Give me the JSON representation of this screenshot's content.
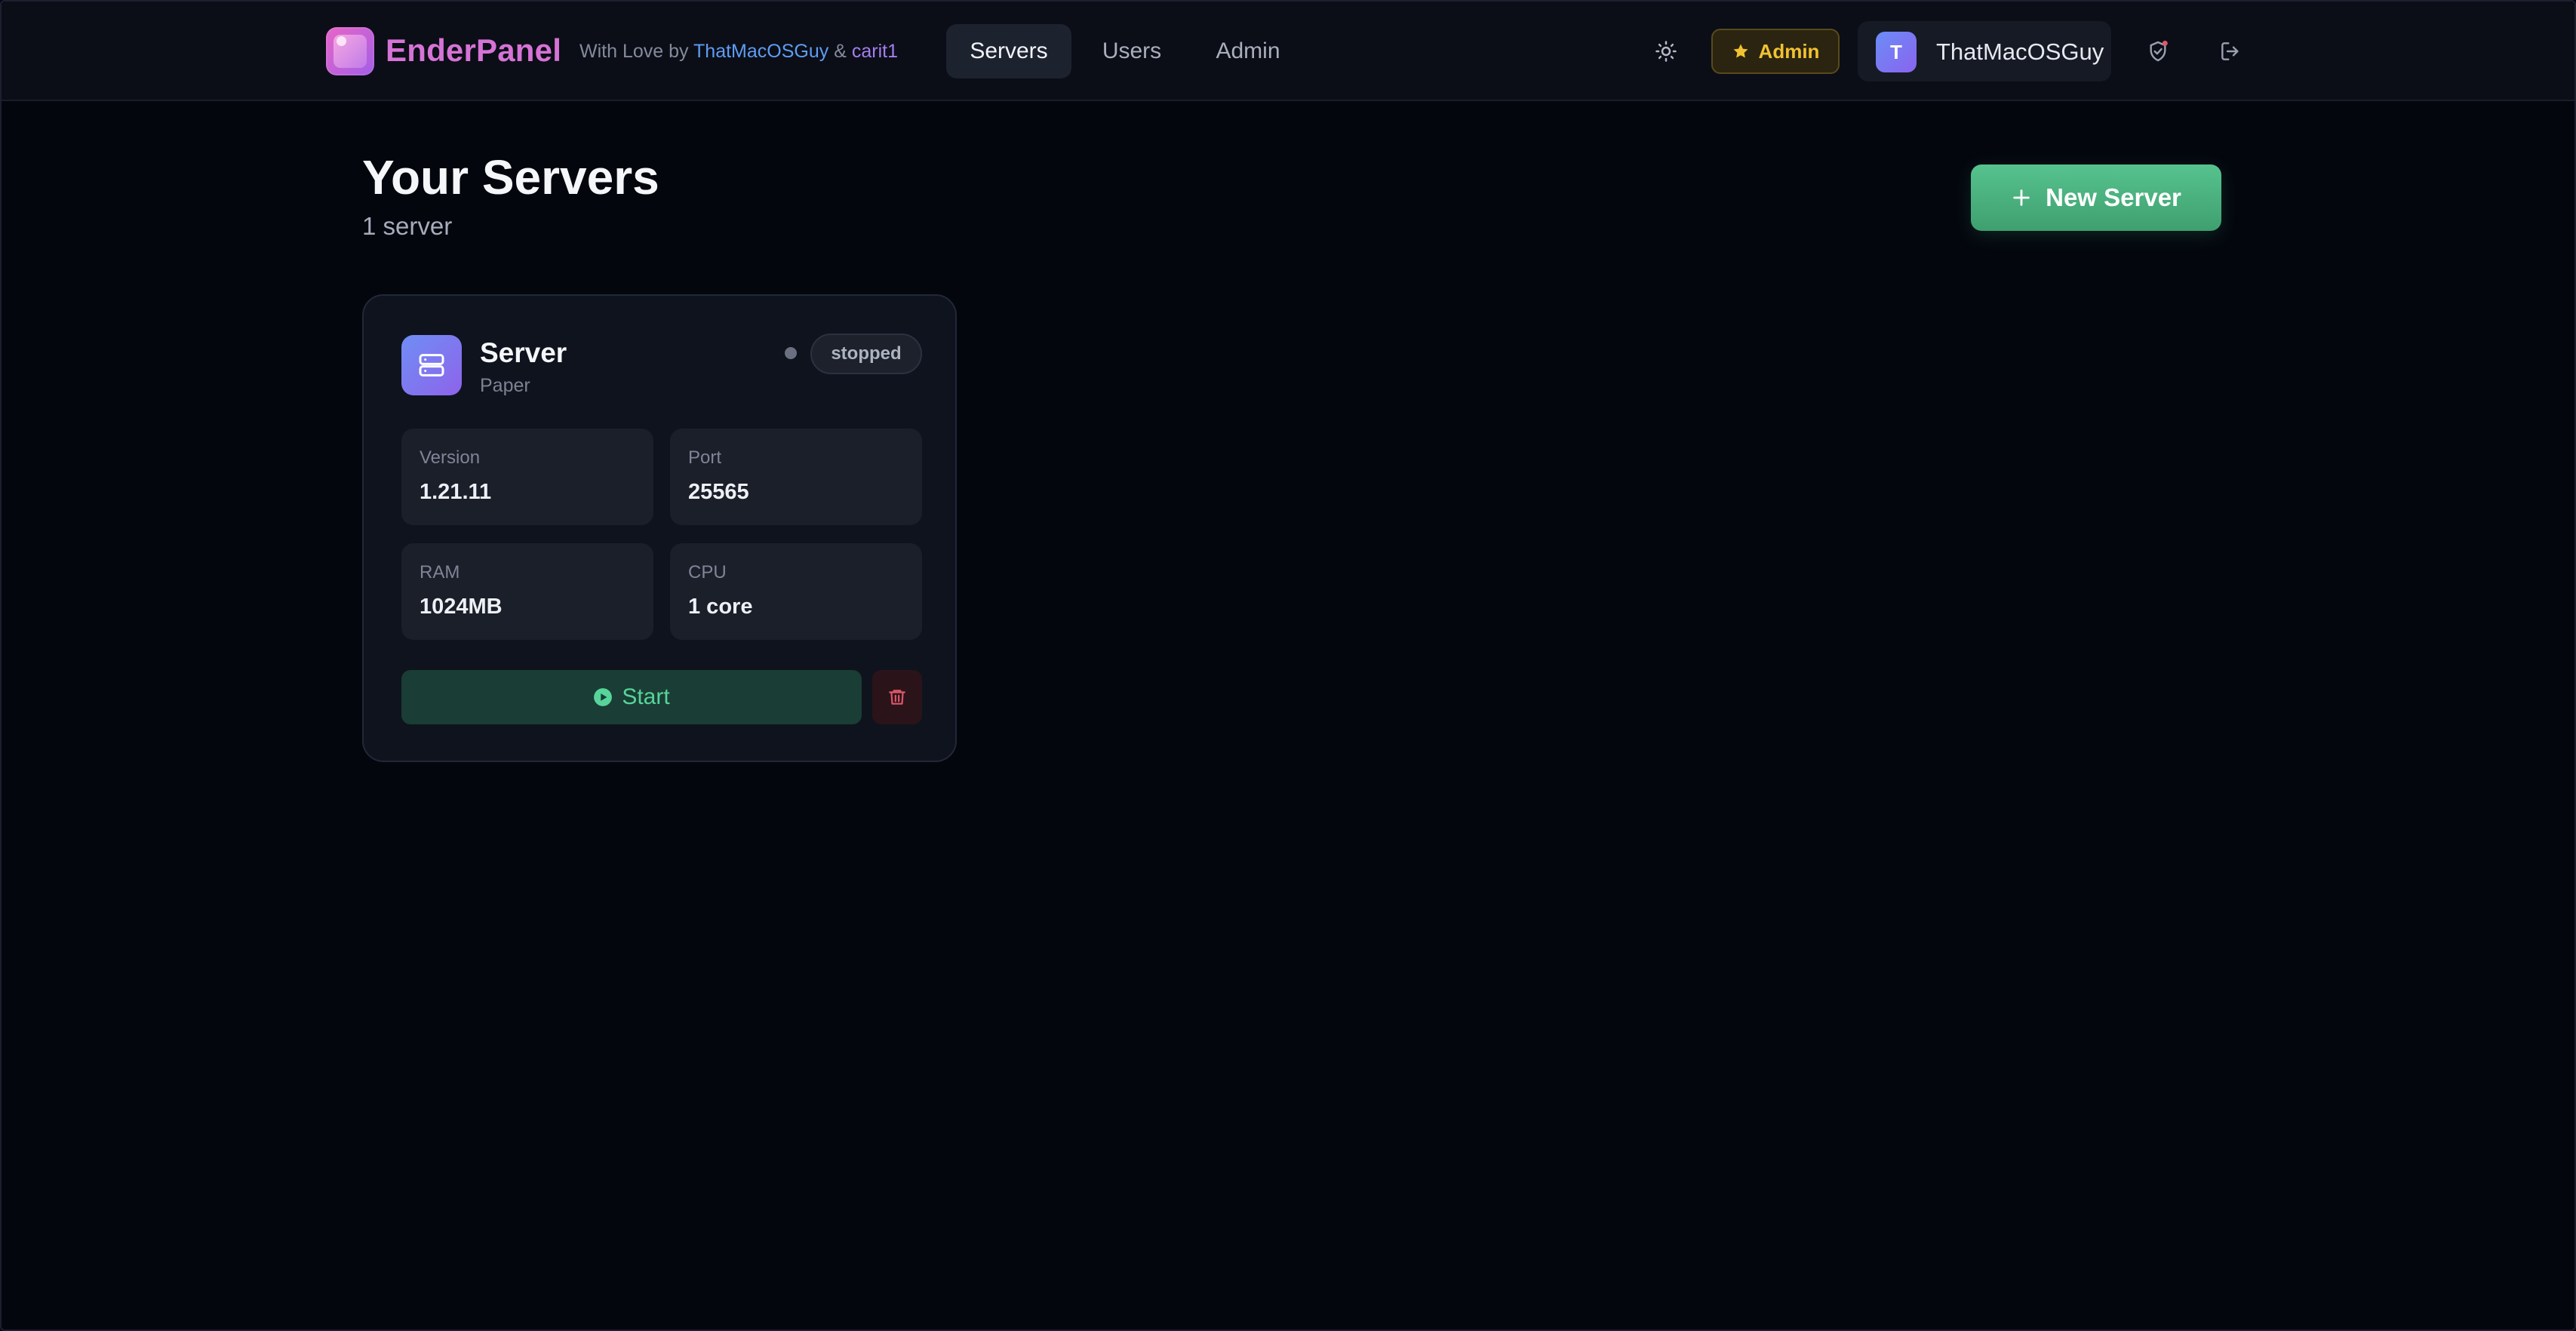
{
  "app": {
    "brand": "EnderPanel",
    "credit_prefix": "With Love by",
    "author1": "ThatMacOSGuy",
    "credit_and": "&",
    "author2": "carit1"
  },
  "nav": {
    "tabs": [
      {
        "label": "Servers",
        "active": true
      },
      {
        "label": "Users",
        "active": false
      },
      {
        "label": "Admin",
        "active": false
      }
    ]
  },
  "header": {
    "theme_icon": "sun-icon",
    "role_badge": "Admin",
    "role_icon": "star-icon",
    "user": {
      "initial": "T",
      "name": "ThatMacOSGuy"
    },
    "shield_icon": "shield-check-icon",
    "logout_icon": "logout-icon"
  },
  "main": {
    "title": "Your Servers",
    "count_text": "1 server",
    "new_server_label": "New Server"
  },
  "servers": [
    {
      "name": "Server",
      "type": "Paper",
      "status": "stopped",
      "stats": {
        "version_label": "Version",
        "version": "1.21.11",
        "port_label": "Port",
        "port": "25565",
        "ram_label": "RAM",
        "ram": "1024MB",
        "cpu_label": "CPU",
        "cpu": "1 core"
      },
      "start_label": "Start"
    }
  ],
  "colors": {
    "background": "#04060e",
    "brand": "#d673d6",
    "accent_green": "#56c38e",
    "admin_gold": "#f1c232",
    "danger": "#e0566a"
  }
}
